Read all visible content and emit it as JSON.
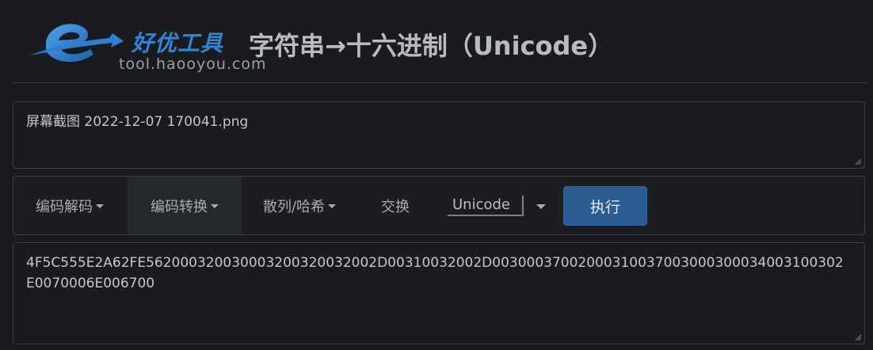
{
  "header": {
    "logo_cn": "好优工具",
    "logo_url": "tool.haooyou.com",
    "title": "字符串→十六进制（Unicode）"
  },
  "input": {
    "value": "屏幕截图 2022-12-07 170041.png"
  },
  "toolbar": {
    "menus": [
      {
        "label": "编码解码"
      },
      {
        "label": "编码转换"
      },
      {
        "label": "散列/哈希"
      }
    ],
    "swap_label": "交换",
    "encoding_selected": "Unicode",
    "run_label": "执行"
  },
  "output": {
    "value": "4F5C555E2A62FE562000320030003200320032002D00310032002D00300037002000310037003000300034003100302E0070006E006700"
  },
  "colors": {
    "background": "#1a1b1e",
    "run_button": "#2b5d93",
    "logo_blue": "#2f86d6"
  }
}
